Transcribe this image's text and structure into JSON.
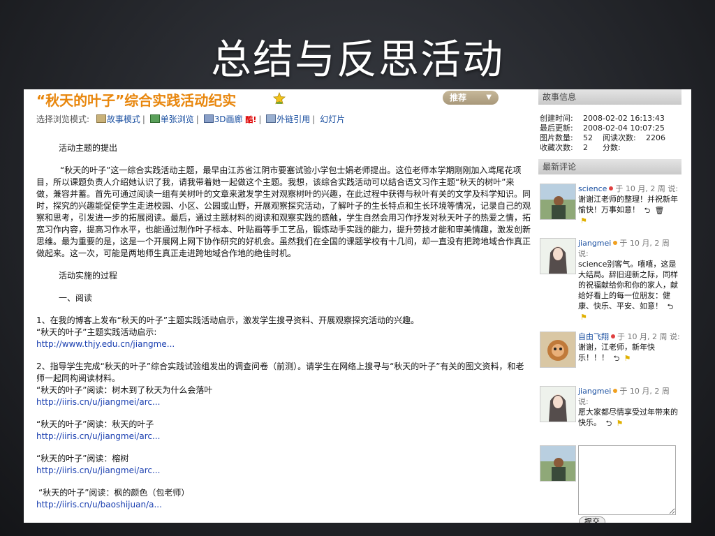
{
  "slide": {
    "title": "总结与反思活动"
  },
  "story": {
    "title": "“秋天的叶子”综合实践活动纪实",
    "recommend_label": "推荐",
    "modes_label": "选择浏览模式:",
    "modes": [
      "故事模式",
      "单张浏览",
      "3D画廊",
      "外链引用",
      "幻灯片"
    ],
    "new_badge": "酷!",
    "heading1": "活动主题的提出",
    "para1": "“秋天的叶子”这一综合实践活动主题，最早由江苏省江阴市要塞试验小学包士娟老师提出。这位老师本学期刚刚加入鸢尾花项目，所以课题负责人介绍她认识了我，请我带着她一起做这个主题。我想，该综合实践活动可以结合语文习作主题“秋天的树叶”来做，兼容并蓄。首先可通过阅读一组有关树叶的文章来激发学生对观察树叶的兴趣，在此过程中获得与秋叶有关的文学及科学知识。同时，探究的兴趣能促使学生走进校园、小区、公园或山野，开展观察探究活动，了解叶子的生长特点和生长环境等情况，记录自己的观察和思考，引发进一步的拓展阅读。最后，通过主题材料的阅读和观察实践的感触，学生自然会用习作抒发对秋天叶子的热爱之情，拓宽习作内容，提高习作水平，也能通过制作叶子标本、叶贴画等手工艺品，锻炼动手实践的能力，提升劳技才能和审美情趣，激发创新思维。最为重要的是，这是一个开展网上网下协作研究的好机会。虽然我们在全国的课题学校有十几间，却一直没有把跨地域合作真正做起来。这一次，可能是两地师生真正走进跨地域合作地的绝佳时机。",
    "heading2": "活动实施的过程",
    "heading3": "一、阅读",
    "item1": "1、在我的博客上发布“秋天的叶子”主题实践活动启示，激发学生搜寻资料、开展观察探究活动的兴趣。",
    "item1_sub": "“秋天的叶子”主题实践活动启示:",
    "item1_link": "http://www.thjy.edu.cn/jiangme...",
    "item2": "2、指导学生完成“秋天的叶子”综合实践试验组发出的调查问卷（前测）。请学生在网络上搜寻与“秋天的叶子”有关的图文资料，和老师一起同构阅读材料。",
    "read1_label": "“秋天的叶子”阅读：树木到了秋天为什么会落叶",
    "read1_link": "http://iiris.cn/u/jiangmei/arc...",
    "read2_label": "“秋天的叶子”阅读：秋天的叶子",
    "read2_link": "http://iiris.cn/u/jiangmei/arc...",
    "read3_label": "“秋天的叶子”阅读：榕树",
    "read3_link": "http://iiris.cn/u/jiangmei/arc...",
    "read4_label": "“秋天的叶子”阅读：枫的颜色（包老师）",
    "read4_link": "http://iiris.cn/u/baoshijuan/a..."
  },
  "sidebar": {
    "info_head": "故事信息",
    "created_label": "创建时间:",
    "created": "2008-02-02 16:13:43",
    "updated_label": "最后更新:",
    "updated": "2008-02-04 10:07:25",
    "pics_label": "图片数量:",
    "pics": "52",
    "reads_label": "阅读次数:",
    "reads": "2206",
    "favs_label": "收藏次数:",
    "favs": "2",
    "score_label": "分数:",
    "comments_head": "最新评论",
    "comments": [
      {
        "name": "science",
        "meta": "于 10 月, 2 周 说:",
        "text": "谢谢江老师的整理！并祝新年愉快！万事如意！"
      },
      {
        "name": "jiangmei",
        "meta": "于 10 月, 2 周 说:",
        "text": "science别客气。嘻嘻，这是大结局。辞旧迎新之际，同样的祝福献给你和你的家人，献给好看上的每一位朋友：健康、快乐、平安、如意！"
      },
      {
        "name": "自由飞翔",
        "meta": "于 10 月, 2 周 说:",
        "text": "谢谢，江老师，新年快乐！！！"
      },
      {
        "name": "jiangmei",
        "meta": "于 10 月, 2 周 说:",
        "text": "愿大家都尽情享受过年带来的快乐。"
      }
    ],
    "submit_label": "提交"
  }
}
